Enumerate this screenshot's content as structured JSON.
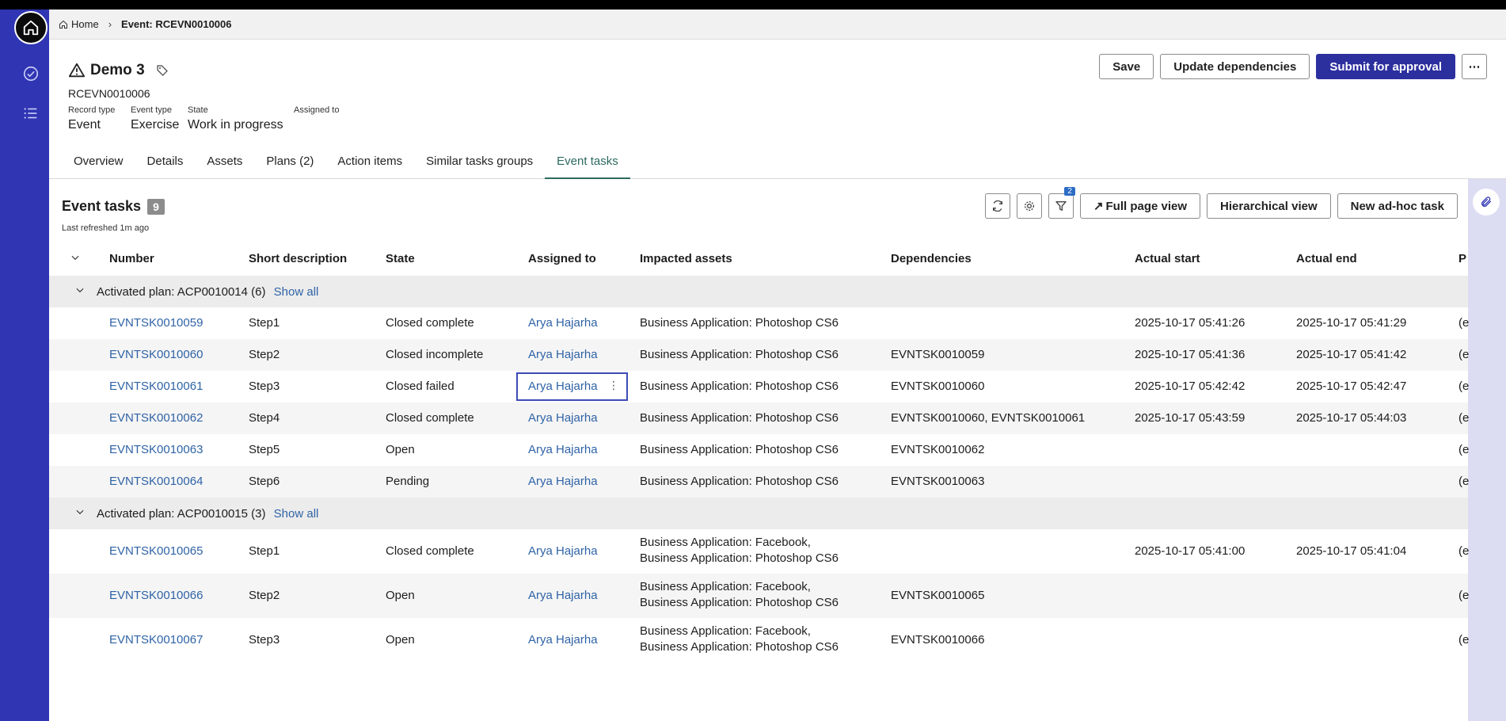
{
  "breadcrumb": {
    "home": "Home",
    "current": "Event: RCEVN0010006"
  },
  "record": {
    "title": "Demo 3",
    "number": "RCEVN0010006",
    "fields": [
      {
        "label": "Record type",
        "value": "Event"
      },
      {
        "label": "Event type",
        "value": "Exercise"
      },
      {
        "label": "State",
        "value": "Work in progress"
      },
      {
        "label": "Assigned to",
        "value": ""
      }
    ]
  },
  "actions": {
    "save": "Save",
    "update": "Update dependencies",
    "submit": "Submit for approval",
    "more": "⋯"
  },
  "tabs": [
    "Overview",
    "Details",
    "Assets",
    "Plans (2)",
    "Action items",
    "Similar tasks groups",
    "Event tasks"
  ],
  "panel": {
    "title": "Event tasks",
    "count": "9",
    "refreshed": "Last refreshed 1m ago",
    "filter_badge": "2",
    "full_page": "Full page view",
    "hierarchical": "Hierarchical view",
    "new_task": "New ad-hoc task"
  },
  "columns": [
    "Number",
    "Short description",
    "State",
    "Assigned to",
    "Impacted assets",
    "Dependencies",
    "Actual start",
    "Actual end",
    "P"
  ],
  "groups": [
    {
      "label": "Activated plan: ACP0010014 (6)",
      "show_all": "Show all",
      "rows": [
        {
          "number": "EVNTSK0010059",
          "desc": "Step1",
          "state": "Closed complete",
          "assigned": "Arya Hajarha",
          "assets": "Business Application: Photoshop CS6",
          "assets2": "",
          "deps": "",
          "start": "2025-10-17 05:41:26",
          "end": "2025-10-17 05:41:29",
          "p": "(e"
        },
        {
          "number": "EVNTSK0010060",
          "desc": "Step2",
          "state": "Closed incomplete",
          "assigned": "Arya Hajarha",
          "assets": "Business Application: Photoshop CS6",
          "assets2": "",
          "deps": "EVNTSK0010059",
          "start": "2025-10-17 05:41:36",
          "end": "2025-10-17 05:41:42",
          "p": "(e"
        },
        {
          "number": "EVNTSK0010061",
          "desc": "Step3",
          "state": "Closed failed",
          "assigned": "Arya Hajarha",
          "assets": "Business Application: Photoshop CS6",
          "assets2": "",
          "deps": "EVNTSK0010060",
          "start": "2025-10-17 05:42:42",
          "end": "2025-10-17 05:42:47",
          "p": "(e"
        },
        {
          "number": "EVNTSK0010062",
          "desc": "Step4",
          "state": "Closed complete",
          "assigned": "Arya Hajarha",
          "assets": "Business Application: Photoshop CS6",
          "assets2": "",
          "deps": "EVNTSK0010060, EVNTSK0010061",
          "start": "2025-10-17 05:43:59",
          "end": "2025-10-17 05:44:03",
          "p": "(e"
        },
        {
          "number": "EVNTSK0010063",
          "desc": "Step5",
          "state": "Open",
          "assigned": "Arya Hajarha",
          "assets": "Business Application: Photoshop CS6",
          "assets2": "",
          "deps": "EVNTSK0010062",
          "start": "",
          "end": "",
          "p": "(e"
        },
        {
          "number": "EVNTSK0010064",
          "desc": "Step6",
          "state": "Pending",
          "assigned": "Arya Hajarha",
          "assets": "Business Application: Photoshop CS6",
          "assets2": "",
          "deps": "EVNTSK0010063",
          "start": "",
          "end": "",
          "p": "(e"
        }
      ]
    },
    {
      "label": "Activated plan: ACP0010015 (3)",
      "show_all": "Show all",
      "rows": [
        {
          "number": "EVNTSK0010065",
          "desc": "Step1",
          "state": "Closed complete",
          "assigned": "Arya Hajarha",
          "assets": "Business Application: Facebook,",
          "assets2": "Business Application: Photoshop CS6",
          "deps": "",
          "start": "2025-10-17 05:41:00",
          "end": "2025-10-17 05:41:04",
          "p": "(e"
        },
        {
          "number": "EVNTSK0010066",
          "desc": "Step2",
          "state": "Open",
          "assigned": "Arya Hajarha",
          "assets": "Business Application: Facebook,",
          "assets2": "Business Application: Photoshop CS6",
          "deps": "EVNTSK0010065",
          "start": "",
          "end": "",
          "p": "(e"
        },
        {
          "number": "EVNTSK0010067",
          "desc": "Step3",
          "state": "Open",
          "assigned": "Arya Hajarha",
          "assets": "Business Application: Facebook,",
          "assets2": "Business Application: Photoshop CS6",
          "deps": "EVNTSK0010066",
          "start": "",
          "end": "",
          "p": "(e"
        }
      ]
    }
  ]
}
